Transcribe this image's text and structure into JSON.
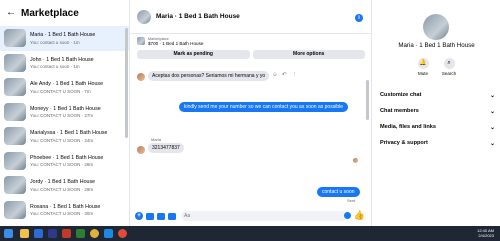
{
  "marketplace": {
    "title": "Marketplace",
    "conversations": [
      {
        "name": "Maria · 1 Bed 1 Bath House",
        "preview": "You: contact u soon · 1m"
      },
      {
        "name": "John · 1 Bed 1 Bath House",
        "preview": "You: contact u soon · 1m"
      },
      {
        "name": "Ale Andy · 1 Bed 1 Bath House",
        "preview": "You: CONTACT U SOON · 7m"
      },
      {
        "name": "Moneyy · 1 Bed 1 Bath House",
        "preview": "You: CONTACT U SOON · 27m"
      },
      {
        "name": "Marialyssa · 1 Bed 1 Bath House",
        "preview": "You: CONTACT U SOON · 24m"
      },
      {
        "name": "Phoebee · 1 Bed 1 Bath House",
        "preview": "You: CONTACT U SOON · 28m"
      },
      {
        "name": "Jordy · 1 Bed 1 Bath House",
        "preview": "You: CONTACT U SOON · 29m"
      },
      {
        "name": "Roxana · 1 Bed 1 Bath House",
        "preview": "You: CONTACT U SOON · 30m"
      }
    ]
  },
  "chat": {
    "title": "Maria · 1 Bed 1 Bath House",
    "listing_label": "Marketplace",
    "listing_desc": "$700 · 1 Bed 1 Bath House",
    "mark_pending": "Mark as pending",
    "more_options": "More options",
    "messages": {
      "m1": "Aceptas dos personas? Seriamos mi hermana y yo",
      "m2": "kindly send me your number so we can contact you as soon as possible",
      "sender": "Maria",
      "m3": "3213477837",
      "m4": "contact u soon",
      "sent": "Sent"
    },
    "input_placeholder": "Aa"
  },
  "details": {
    "name": "Maria · 1 Bed 1 Bath House",
    "mute": "Mute",
    "search": "Search",
    "items": [
      "Customize chat",
      "Chat members",
      "Media, files and links",
      "Privacy & support"
    ]
  },
  "taskbar": {
    "time": "12:40 AM",
    "date": "2/4/2023"
  },
  "colors": {
    "accent": "#1877f2",
    "active_bg": "#e7f0fd"
  }
}
